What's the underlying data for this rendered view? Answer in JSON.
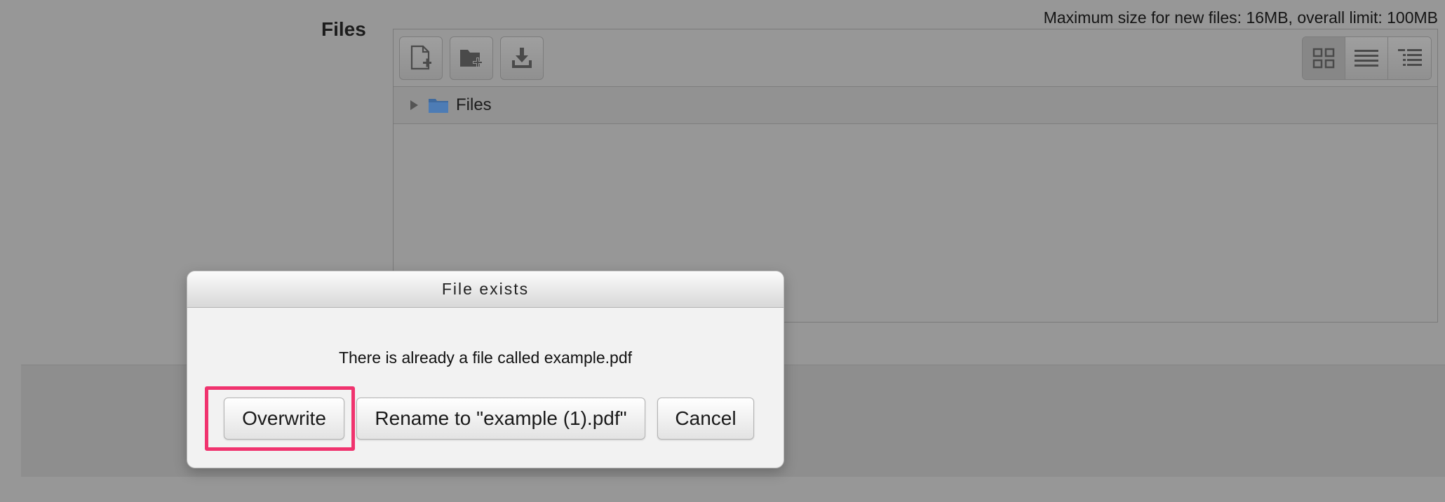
{
  "form": {
    "field_label": "Files",
    "limit_text": "Maximum size for new files: 16MB, overall limit: 100MB"
  },
  "filemanager": {
    "toolbar": {
      "buttons": [
        {
          "icon": "add-file-icon"
        },
        {
          "icon": "create-folder-icon"
        },
        {
          "icon": "download-icon"
        }
      ],
      "views": [
        {
          "icon": "grid-view-icon",
          "active": true
        },
        {
          "icon": "list-view-icon",
          "active": false
        },
        {
          "icon": "tree-view-icon",
          "active": false
        }
      ]
    },
    "path": {
      "label": "Files",
      "icon": "folder-icon"
    }
  },
  "dialog": {
    "title": "File exists",
    "message": "There is already a file called example.pdf",
    "buttons": {
      "overwrite": "Overwrite",
      "rename": "Rename to \"example (1).pdf\"",
      "cancel": "Cancel"
    }
  },
  "colors": {
    "overlay": "#979797",
    "highlight": "#f0336e",
    "dialog_bg": "#f2f2f2"
  }
}
